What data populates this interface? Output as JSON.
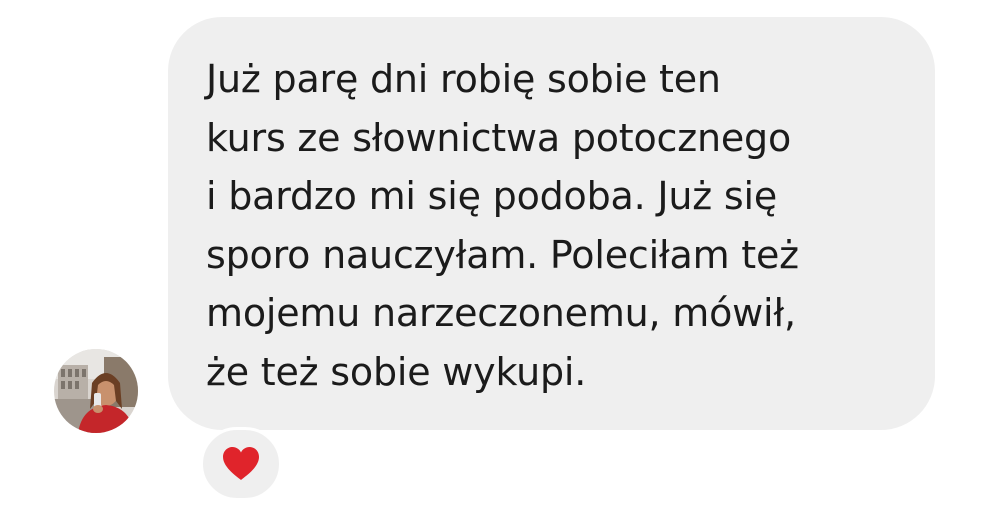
{
  "message": {
    "lines": [
      "Już parę dni robię sobie ten",
      "kurs ze słownictwa potocznego",
      "i bardzo mi się podoba. Już się",
      "sporo nauczyłam. Poleciłam też",
      "mojemu narzeczonemu, mówił,",
      "że też sobie wykupi."
    ]
  },
  "reaction": {
    "icon": "heart-icon",
    "color": "#e0242b"
  },
  "sender": {
    "avatar_icon": "avatar"
  },
  "colors": {
    "bubble": "#efefef",
    "text": "#1b1b1b",
    "background": "#ffffff"
  }
}
